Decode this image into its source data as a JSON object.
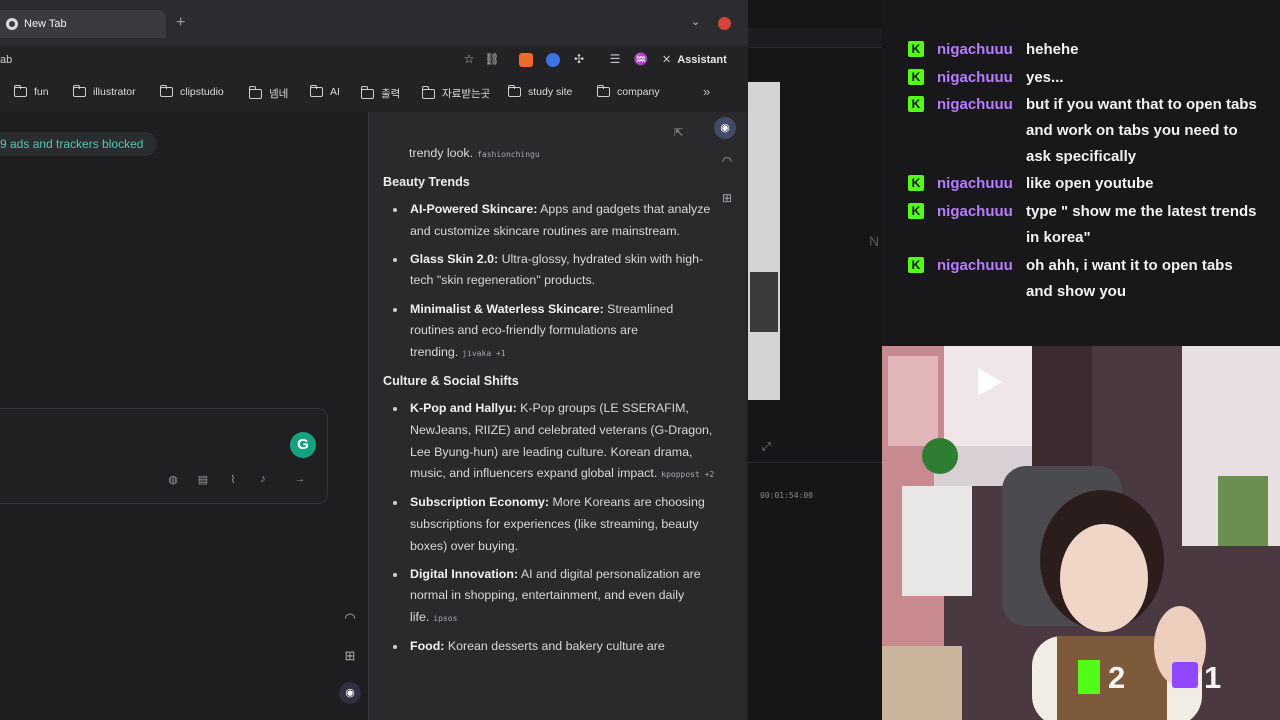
{
  "browser": {
    "tab_title": "New Tab",
    "url_fragment": "ab",
    "assistant_label": "Assistant",
    "bookmarks": [
      "fun",
      "illustrator",
      "clipstudio",
      "넴네",
      "AI",
      "출력",
      "자료받는곳",
      "study site",
      "company"
    ]
  },
  "newtab": {
    "adblock_text": "9 ads and trackers blocked"
  },
  "assistant": {
    "intro_trail": "trendy look.",
    "intro_source": "fashionchingu",
    "sections": [
      {
        "title": "Beauty Trends",
        "items": [
          {
            "bold": "AI-Powered Skincare:",
            "text": " Apps and gadgets that analyze and customize skincare routines are mainstream.",
            "source": ""
          },
          {
            "bold": "Glass Skin 2.0:",
            "text": " Ultra-glossy, hydrated skin with high-tech \"skin regeneration\" products.",
            "source": ""
          },
          {
            "bold": "Minimalist & Waterless Skincare:",
            "text": " Streamlined routines and eco-friendly formulations are trending.",
            "source": "jivaka +1"
          }
        ]
      },
      {
        "title": "Culture & Social Shifts",
        "items": [
          {
            "bold": "K-Pop and Hallyu:",
            "text": " K-Pop groups (LE SSERAFIM, NewJeans, RIIZE) and celebrated veterans (G-Dragon, Lee Byung-hun) are leading culture. Korean drama, music, and influencers expand global impact.",
            "source": "kpoppost +2"
          },
          {
            "bold": "Subscription Economy:",
            "text": " More Koreans are choosing subscriptions for experiences (like streaming, beauty boxes) over buying.",
            "source": ""
          },
          {
            "bold": "Digital Innovation:",
            "text": " AI and digital personalization are normal in shopping, entertainment, and even daily life.",
            "source": "ipsos"
          },
          {
            "bold": "Food:",
            "text": " Korean desserts and bakery culture are",
            "source": ""
          }
        ]
      }
    ]
  },
  "editor": {
    "timecode": "00:01:54:00"
  },
  "chat": {
    "messages": [
      {
        "user": "nigachuuu",
        "text": "hehehe"
      },
      {
        "user": "nigachuuu",
        "text": "yes..."
      },
      {
        "user": "nigachuuu",
        "text": "but if you want that to open tabs and work on tabs you need to ask specifically"
      },
      {
        "user": "nigachuuu",
        "text": "like open youtube"
      },
      {
        "user": "nigachuuu",
        "text": "type \" show me the latest trends in korea\""
      },
      {
        "user": "nigachuuu",
        "text": "oh ahh, i want it to open tabs and show you"
      }
    ]
  },
  "overlay": {
    "kick_count": "2",
    "twitch_count": "1"
  },
  "colors": {
    "kick_green": "#53fc18",
    "username_purple": "#b77cff",
    "twitch_purple": "#9146ff",
    "adblock_teal": "#53c6bc"
  }
}
